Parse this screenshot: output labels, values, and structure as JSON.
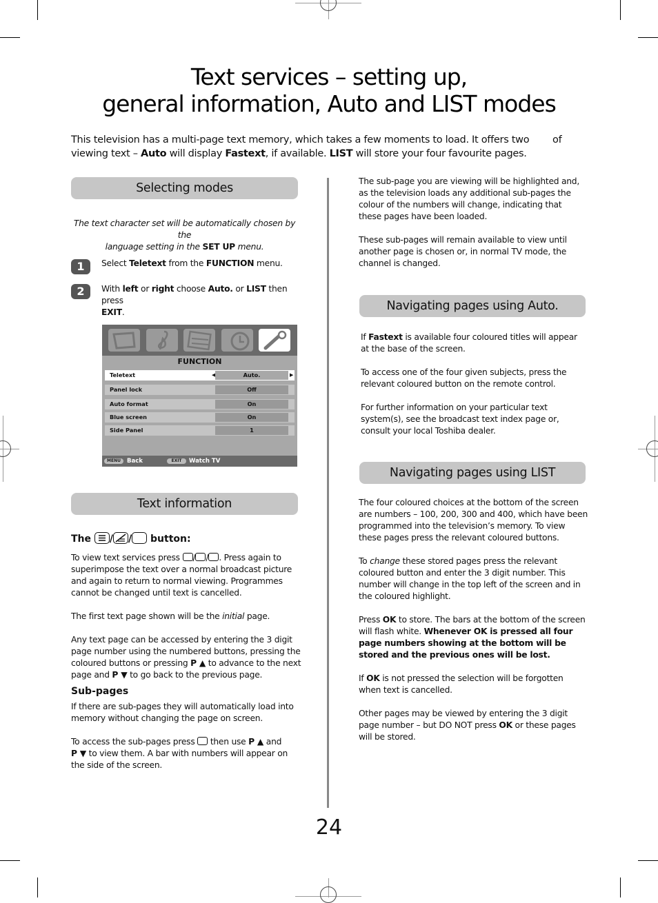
{
  "page": {
    "title_line1": "Text services – setting up,",
    "title_line2": "general information, Auto and LIST modes",
    "intro": {
      "part1": "This television has a multi-page text memory, which takes a few moments to load. It offers two",
      "of": "of",
      "part2a": "viewing text – ",
      "auto": "Auto",
      "part2b": " will display ",
      "fastext": "Fastext",
      "part2c": ", if available. ",
      "list": "LIST",
      "part2d": " will store your four favourite pages."
    },
    "page_number": "24"
  },
  "selecting_modes": {
    "heading": "Selecting modes",
    "note_a": "The text character set will be automatically chosen by the",
    "note_b": "language setting in the ",
    "note_bold": "SET UP",
    "note_c": " menu.",
    "steps": [
      {
        "num": "1",
        "a": "Select ",
        "b1": "Teletext",
        "c": " from the ",
        "b2": "FUNCTION",
        "d": " menu."
      },
      {
        "num": "2",
        "a": "With ",
        "b1": "left",
        "c": " or ",
        "b2": "right",
        "d": " choose ",
        "b3": "Auto.",
        "e": " or ",
        "b4": "LIST",
        "f": " then press",
        "b5": "EXIT",
        "g": "."
      }
    ]
  },
  "tv_menu": {
    "icons": [
      "tv-picture-icon",
      "music-sound-icon",
      "settings-sliders-icon",
      "clock-timer-icon",
      "wrench-function-icon"
    ],
    "title": "FUNCTION",
    "rows": [
      {
        "label": "Teletext",
        "value": "Auto.",
        "selected": true
      },
      {
        "label": "Panel lock",
        "value": "Off"
      },
      {
        "label": "Auto format",
        "value": "On"
      },
      {
        "label": "Blue screen",
        "value": "On"
      },
      {
        "label": "Side Panel",
        "value": "1"
      }
    ],
    "footer": {
      "menu_key": "MENU",
      "back": "Back",
      "exit_key": "EXIT",
      "watch_tv": "Watch TV"
    }
  },
  "text_information": {
    "heading": "Text information",
    "btn_heading_the": "The",
    "btn_heading_button": "button:",
    "p1_a": "To view text services press",
    "p1_b": ". Press again to superimpose the text over a normal broadcast picture and again to return to normal viewing. Programmes cannot be changed until text is cancelled.",
    "p2_a": "The first text page shown will be the ",
    "p2_i": "initial",
    "p2_b": " page.",
    "p3_a": "Any text page can be accessed by entering the 3 digit page number using the numbered buttons, pressing the coloured buttons or pressing ",
    "p3_p1": "P ▲",
    "p3_b": " to advance to the next page and ",
    "p3_p2": "P ▼",
    "p3_c": " to go back to the previous page.",
    "subpages_heading": "Sub-pages",
    "p4": "If there are sub-pages they will automatically load into memory without changing the page on screen.",
    "p5_a": "To access the sub-pages press",
    "p5_b": " then use ",
    "p5_p1": "P ▲",
    "p5_c": " and ",
    "p5_p2": "P ▼",
    "p5_d": " to view them. A bar with numbers will appear on the side of the screen."
  },
  "right_column": {
    "p1": "The sub-page you are viewing will be highlighted and, as the television loads any additional sub-pages the colour of the numbers will change, indicating that these pages have been loaded.",
    "p2": "These sub-pages will remain available to view until another page is chosen or, in normal TV mode, the channel is changed.",
    "auto_heading": "Navigating pages using Auto.",
    "auto_p1_a": "If ",
    "auto_p1_b": "Fastext",
    "auto_p1_c": " is available four coloured titles will appear at the base of the screen.",
    "auto_p2": "To access one of the four given subjects, press the relevant coloured button on the remote control.",
    "auto_p3": "For further information on your particular text system(s), see the broadcast text index page or, consult your local Toshiba dealer.",
    "list_heading": "Navigating pages using LIST",
    "list_p1": "The four coloured choices at the bottom of the screen are numbers – 100, 200, 300 and 400, which have been programmed into the television’s memory. To view these pages press the relevant coloured buttons.",
    "list_p2_a": "To ",
    "list_p2_i": "change",
    "list_p2_b": " these stored pages press the relevant coloured button and enter the 3 digit number. This number will change in the top left of the screen and in the coloured highlight.",
    "list_p3_a": "Press ",
    "list_p3_ok": "OK",
    "list_p3_b": " to store. The bars at the bottom of the screen will flash white. ",
    "list_p3_bold": "Whenever OK is pressed all four page numbers showing at the bottom will be stored and the previous ones will be lost.",
    "list_p4_a": "If ",
    "list_p4_ok": "OK",
    "list_p4_b": " is not pressed the selection will be forgotten when text is cancelled.",
    "list_p5_a": "Other pages may be viewed by entering the 3 digit page number – but DO NOT press ",
    "list_p5_ok": "OK",
    "list_p5_b": " or these pages will be stored."
  }
}
